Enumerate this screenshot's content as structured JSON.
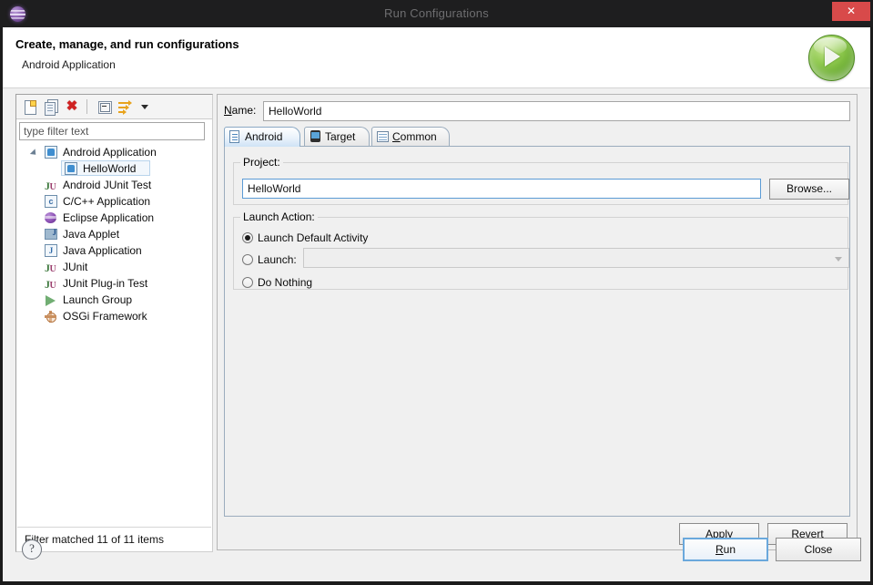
{
  "window": {
    "title": "Run Configurations",
    "close_label": "✕",
    "app_icon": "eclipse-globe-icon"
  },
  "header": {
    "title": "Create, manage, and run configurations",
    "subtitle": "Android Application",
    "badge_icon": "green-run-play-icon"
  },
  "tree_toolbar": {
    "items": [
      {
        "name": "new-launch-configuration-icon",
        "tooltip": "New launch configuration"
      },
      {
        "name": "duplicate-configuration-icon",
        "tooltip": "Duplicate"
      },
      {
        "name": "delete-configuration-icon",
        "tooltip": "Delete"
      },
      {
        "name": "collapse-all-icon",
        "tooltip": "Collapse All"
      },
      {
        "name": "filter-configurations-icon",
        "tooltip": "Filter"
      },
      {
        "name": "toolbar-menu-chevron-icon",
        "tooltip": "View Menu"
      }
    ]
  },
  "filter": {
    "placeholder": "type filter text",
    "value": "",
    "status": "Filter matched 11 of 11 items"
  },
  "tree": {
    "items": [
      {
        "label": "Android Application",
        "icon": "android-config-icon",
        "indent": 0,
        "expanded": true,
        "selected": false
      },
      {
        "label": "HelloWorld",
        "icon": "android-config-icon",
        "indent": 1,
        "expanded": false,
        "selected": true
      },
      {
        "label": "Android JUnit Test",
        "icon": "android-junit-icon",
        "indent": 0,
        "expanded": false,
        "selected": false
      },
      {
        "label": "C/C++ Application",
        "icon": "cpp-application-icon",
        "indent": 0,
        "expanded": false,
        "selected": false
      },
      {
        "label": "Eclipse Application",
        "icon": "eclipse-application-icon",
        "indent": 0,
        "expanded": false,
        "selected": false
      },
      {
        "label": "Java Applet",
        "icon": "java-applet-icon",
        "indent": 0,
        "expanded": false,
        "selected": false
      },
      {
        "label": "Java Application",
        "icon": "java-application-icon",
        "indent": 0,
        "expanded": false,
        "selected": false
      },
      {
        "label": "JUnit",
        "icon": "junit-icon",
        "indent": 0,
        "expanded": false,
        "selected": false
      },
      {
        "label": "JUnit Plug-in Test",
        "icon": "junit-plugin-test-icon",
        "indent": 0,
        "expanded": false,
        "selected": false
      },
      {
        "label": "Launch Group",
        "icon": "launch-group-icon",
        "indent": 0,
        "expanded": false,
        "selected": false
      },
      {
        "label": "OSGi Framework",
        "icon": "osgi-framework-icon",
        "indent": 0,
        "expanded": false,
        "selected": false
      }
    ]
  },
  "config": {
    "name_label": "Name:",
    "name_mnemonic": "N",
    "name_value": "HelloWorld",
    "tabs": [
      {
        "label": "Android",
        "icon": "android-tab-icon",
        "active": true
      },
      {
        "label": "Target",
        "icon": "target-device-icon",
        "active": false
      },
      {
        "label": "Common",
        "icon": "common-grid-icon",
        "active": false,
        "mnemonic": "C"
      }
    ],
    "project_group": {
      "title": "Project:",
      "value": "HelloWorld",
      "browse_label": "Browse..."
    },
    "launch_action_group": {
      "title": "Launch Action:",
      "options": [
        {
          "label": "Launch Default Activity",
          "selected": true
        },
        {
          "label": "Launch:",
          "selected": false,
          "has_combo": true,
          "combo_value": ""
        },
        {
          "label": "Do Nothing",
          "selected": false
        }
      ]
    },
    "apply_label": "Apply",
    "apply_mnemonic": "y",
    "revert_label": "Revert",
    "revert_mnemonic": "v"
  },
  "footer": {
    "help_icon": "help-question-icon",
    "run_label": "Run",
    "run_mnemonic": "R",
    "close_label": "Close"
  },
  "colors": {
    "titlebar_bg": "#1e1e1f",
    "close_button": "#d84a4a",
    "dialog_bg": "#f0f0f0",
    "header_bg": "#ffffff",
    "accent_focus_border": "#5b9bd5",
    "default_button_border": "#6aa8dc",
    "run_badge_green": "#5ea226",
    "delete_icon_red": "#cf2222"
  }
}
